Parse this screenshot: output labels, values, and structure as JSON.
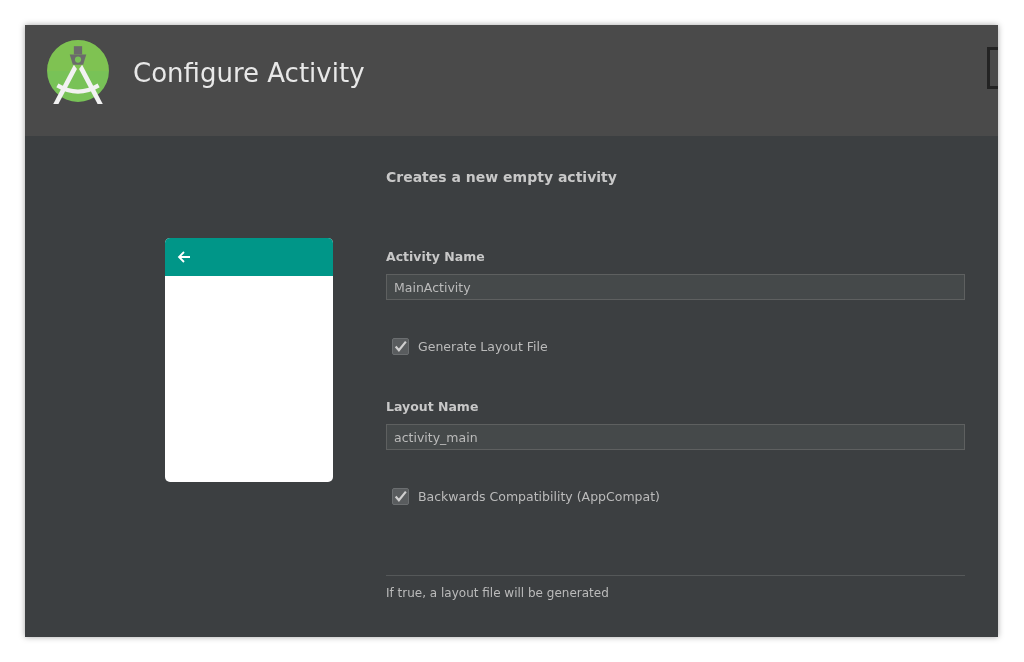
{
  "header": {
    "title": "Configure Activity"
  },
  "description": "Creates a new empty activity",
  "form": [
    {
      "kind": "field",
      "label": "Activity Name",
      "value": "MainActivity"
    },
    {
      "kind": "checkbox",
      "label": "Generate Layout File",
      "checked": true
    },
    {
      "kind": "field",
      "label": "Layout Name",
      "value": "activity_main"
    },
    {
      "kind": "checkbox",
      "label": "Backwards Compatibility (AppCompat)",
      "checked": true
    }
  ],
  "hint": "If true, a layout file will be generated"
}
